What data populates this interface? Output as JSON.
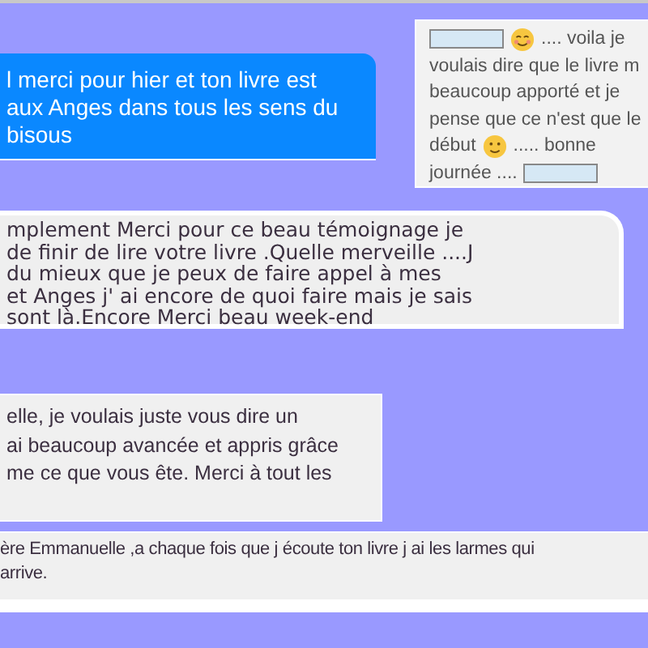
{
  "messages": [
    {
      "kind": "blue",
      "lines": [
        "l merci pour hier et ton livre est",
        "aux Anges dans tous les sens du",
        "bisous"
      ]
    },
    {
      "kind": "card",
      "rows": [
        [
          {
            "kind": "redaction"
          },
          {
            "kind": "blush"
          },
          {
            "kind": "text",
            "text": ".... voila je"
          }
        ],
        [
          {
            "kind": "text",
            "text": "voulais dire que le livre m"
          }
        ],
        [
          {
            "kind": "text",
            "text": "beaucoup apporté et je"
          }
        ],
        [
          {
            "kind": "text",
            "text": "pense que ce n'est que le"
          }
        ],
        [
          {
            "kind": "text",
            "text": "début"
          },
          {
            "kind": "smile"
          },
          {
            "kind": "text",
            "text": "..... bonne"
          }
        ],
        [
          {
            "kind": "text",
            "text": "journée ...."
          },
          {
            "kind": "redaction"
          }
        ]
      ]
    },
    {
      "kind": "rounded",
      "lines": [
        "mplement Merci pour ce beau témoignage je",
        "de finir de lire votre livre .Quelle merveille ....J",
        "du mieux que je peux de faire appel à mes",
        "et Anges j' ai encore de quoi faire mais je sais",
        "sont là.Encore Merci beau week-end"
      ]
    },
    {
      "kind": "box",
      "lines": [
        "elle, je voulais juste vous dire un",
        "ai beaucoup avancée et appris grâce",
        "me ce que vous ête. Merci à tout les"
      ]
    },
    {
      "kind": "strip",
      "lines": [
        "ère Emmanuelle ,a chaque fois que j écoute ton livre j ai les larmes qui",
        "arrive."
      ]
    }
  ]
}
